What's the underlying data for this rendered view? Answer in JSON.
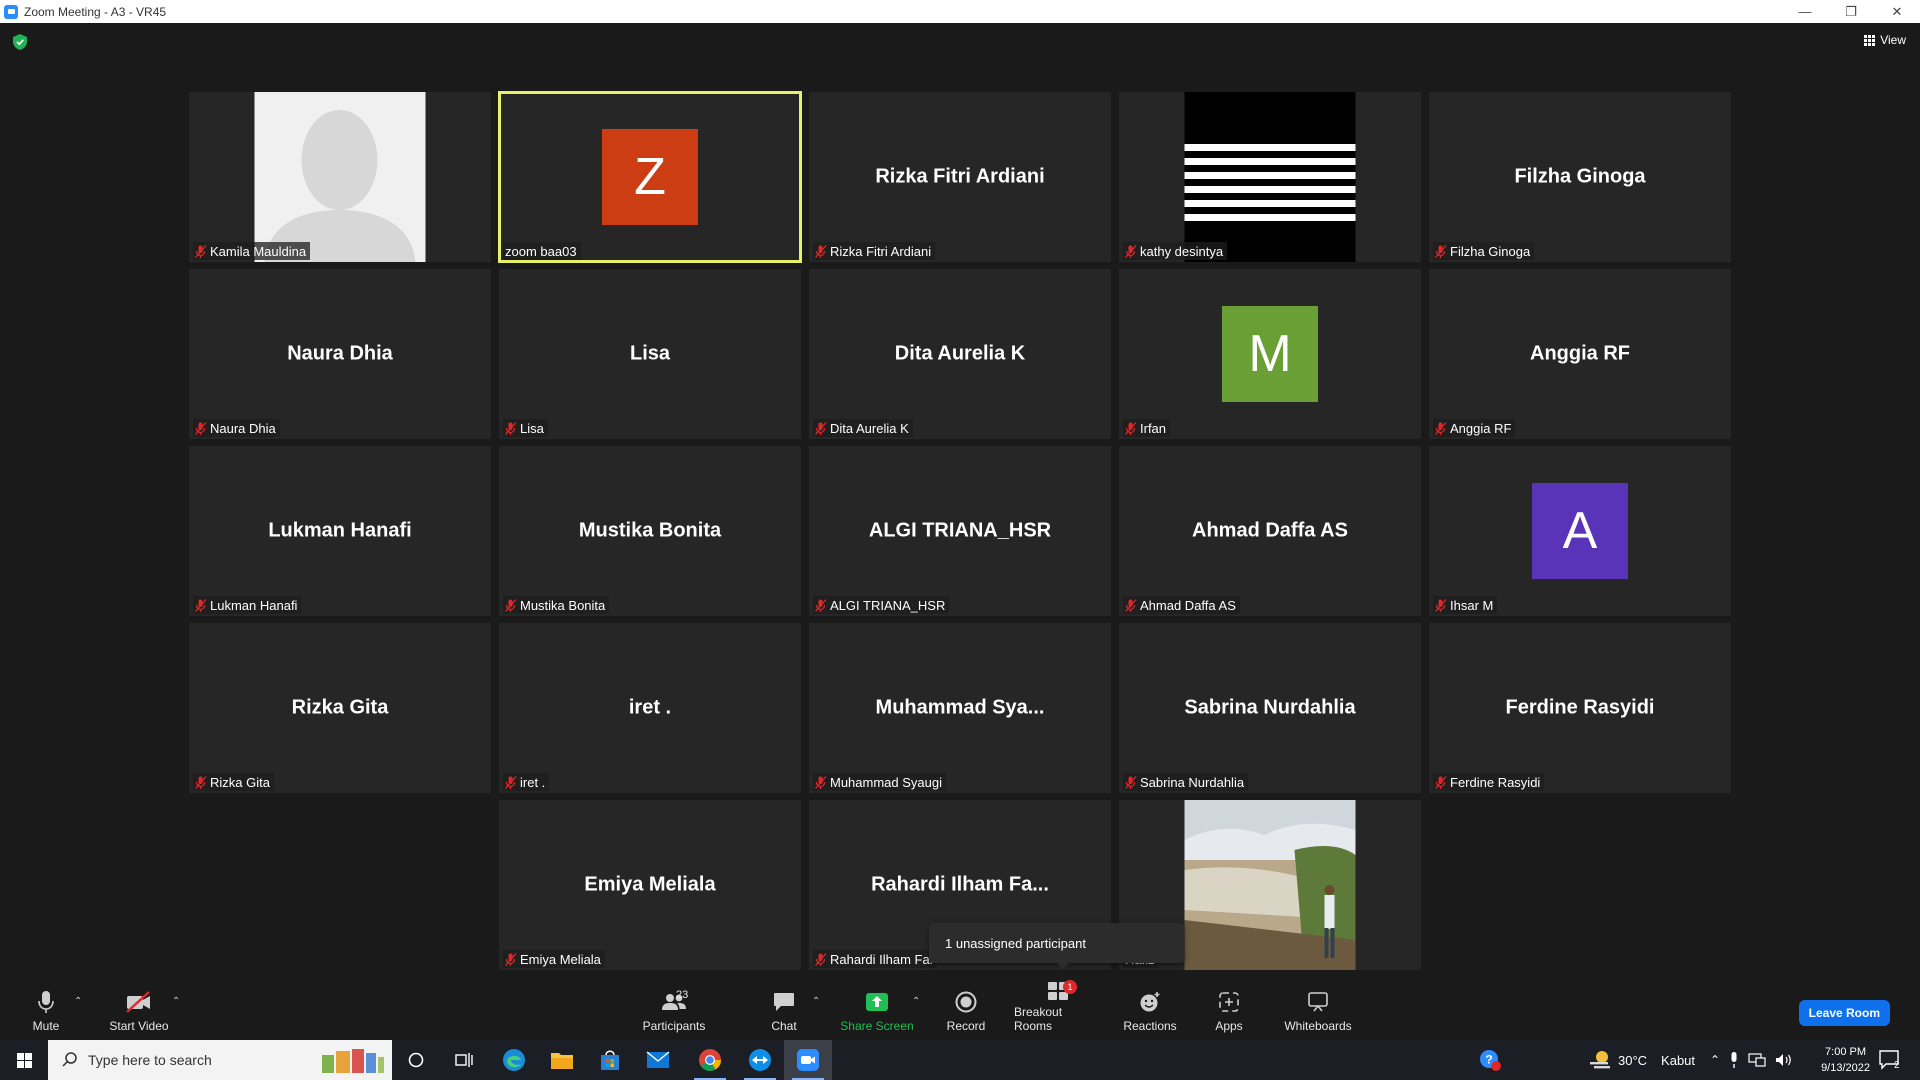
{
  "window": {
    "title": "Zoom Meeting - A3 - VR45"
  },
  "top_bar": {
    "view_label": "View"
  },
  "participants": [
    {
      "display": "",
      "label": "Kamila Mauldina",
      "style": "silhouette",
      "muted": true,
      "active": false
    },
    {
      "display": "Z",
      "label": "zoom baa03",
      "style": "letter",
      "color": "#cc3d14",
      "muted": false,
      "active": true
    },
    {
      "display": "Rizka Fitri Ardiani",
      "label": "Rizka Fitri Ardiani",
      "style": "name",
      "muted": true,
      "active": false
    },
    {
      "display": "",
      "label": "kathy desintya",
      "style": "stripes",
      "muted": true,
      "active": false
    },
    {
      "display": "Filzha Ginoga",
      "label": "Filzha Ginoga",
      "style": "name",
      "muted": true,
      "active": false
    },
    {
      "display": "Naura Dhia",
      "label": "Naura Dhia",
      "style": "name",
      "muted": true,
      "active": false
    },
    {
      "display": "Lisa",
      "label": "Lisa",
      "style": "name",
      "muted": true,
      "active": false
    },
    {
      "display": "Dita Aurelia K",
      "label": "Dita Aurelia K",
      "style": "name",
      "muted": true,
      "active": false
    },
    {
      "display": "M",
      "label": "Irfan",
      "style": "letter",
      "color": "#6a9f35",
      "muted": true,
      "active": false
    },
    {
      "display": "Anggia RF",
      "label": "Anggia RF",
      "style": "name",
      "muted": true,
      "active": false
    },
    {
      "display": "Lukman Hanafi",
      "label": "Lukman Hanafi",
      "style": "name",
      "muted": true,
      "active": false
    },
    {
      "display": "Mustika Bonita",
      "label": "Mustika Bonita",
      "style": "name",
      "muted": true,
      "active": false
    },
    {
      "display": "ALGI TRIANA_HSR",
      "label": "ALGI TRIANA_HSR",
      "style": "name",
      "muted": true,
      "active": false
    },
    {
      "display": "Ahmad Daffa AS",
      "label": "Ahmad Daffa AS",
      "style": "name",
      "muted": true,
      "active": false
    },
    {
      "display": "A",
      "label": "Ihsar M",
      "style": "letter",
      "color": "#5a34b8",
      "muted": true,
      "active": false
    },
    {
      "display": "Rizka Gita",
      "label": "Rizka Gita",
      "style": "name",
      "muted": true,
      "active": false
    },
    {
      "display": "iret .",
      "label": "iret .",
      "style": "name",
      "muted": true,
      "active": false
    },
    {
      "display": "Muhammad  Sya...",
      "label": "Muhammad Syaugi",
      "style": "name",
      "muted": true,
      "active": false
    },
    {
      "display": "Sabrina Nurdahlia",
      "label": "Sabrina Nurdahlia",
      "style": "name",
      "muted": true,
      "active": false
    },
    {
      "display": "Ferdine Rasyidi",
      "label": "Ferdine Rasyidi",
      "style": "name",
      "muted": true,
      "active": false
    },
    {
      "display": "",
      "label": "",
      "style": "empty",
      "muted": false,
      "active": false
    },
    {
      "display": "Emiya Meliala",
      "label": "Emiya Meliala",
      "style": "name",
      "muted": true,
      "active": false
    },
    {
      "display": "Rahardi  Ilham  Fa...",
      "label": "Rahardi Ilham Fal",
      "style": "name",
      "muted": true,
      "active": false
    },
    {
      "display": "",
      "label": "Hafiz",
      "style": "photo",
      "muted": false,
      "active": false
    }
  ],
  "tooltip": {
    "text": "1 unassigned participant"
  },
  "toolbar": {
    "mute": "Mute",
    "start_video": "Start Video",
    "participants": "Participants",
    "participants_count": "23",
    "chat": "Chat",
    "share_screen": "Share Screen",
    "record": "Record",
    "breakout_rooms": "Breakout Rooms",
    "breakout_badge": "1",
    "reactions": "Reactions",
    "apps": "Apps",
    "whiteboards": "Whiteboards",
    "leave": "Leave Room"
  },
  "taskbar": {
    "search_placeholder": "Type here to search",
    "weather_temp": "30°C",
    "weather_text": "Kabut",
    "time": "7:00 PM",
    "date": "9/13/2022",
    "notification_count": "2"
  },
  "colors": {
    "accent": "#0e71eb",
    "active_speaker": "#e6f06b",
    "share_green": "#1fbf54",
    "muted_red": "#e02828"
  }
}
